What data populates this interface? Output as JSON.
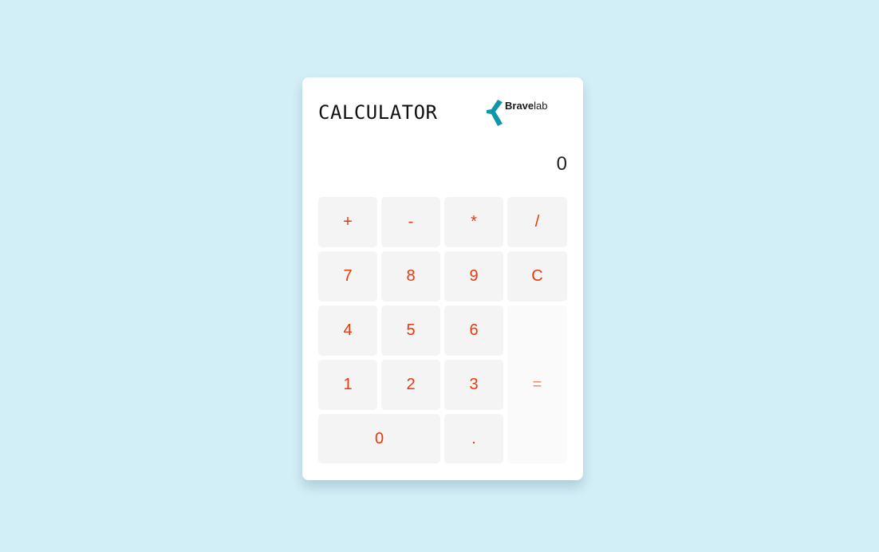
{
  "app": {
    "title": "CALCULATOR",
    "brand": {
      "strong": "Brave",
      "light": "lab",
      "mark_color": "#0e96ac"
    }
  },
  "display": {
    "value": "0"
  },
  "keys": {
    "add": "+",
    "subtract": "-",
    "multiply": "*",
    "divide": "/",
    "seven": "7",
    "eight": "8",
    "nine": "9",
    "clear": "C",
    "four": "4",
    "five": "5",
    "six": "6",
    "one": "1",
    "two": "2",
    "three": "3",
    "zero": "0",
    "dot": ".",
    "equals": "="
  },
  "colors": {
    "background": "#d2eef6",
    "key_text": "#e8380d",
    "key_bg": "#f4f4f4"
  }
}
